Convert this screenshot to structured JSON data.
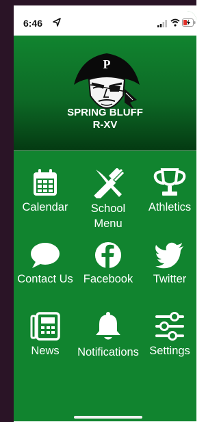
{
  "status_bar": {
    "time": "6:46"
  },
  "header": {
    "school_name_line1": "SPRING BLUFF",
    "school_name_line2": "R-XV"
  },
  "tiles": [
    {
      "label": "Calendar",
      "icon": "calendar-icon"
    },
    {
      "label": "School\nMenu",
      "icon": "utensils-icon"
    },
    {
      "label": "Athletics",
      "icon": "trophy-icon"
    },
    {
      "label": "Contact Us",
      "icon": "chat-bubble-icon"
    },
    {
      "label": "Facebook",
      "icon": "facebook-icon"
    },
    {
      "label": "Twitter",
      "icon": "twitter-icon"
    },
    {
      "label": "News",
      "icon": "newspaper-icon"
    },
    {
      "label": "Notifications",
      "icon": "bell-icon"
    },
    {
      "label": "Settings",
      "icon": "sliders-icon"
    }
  ],
  "colors": {
    "brand_green": "#11842f",
    "header_dark": "#043a12"
  }
}
